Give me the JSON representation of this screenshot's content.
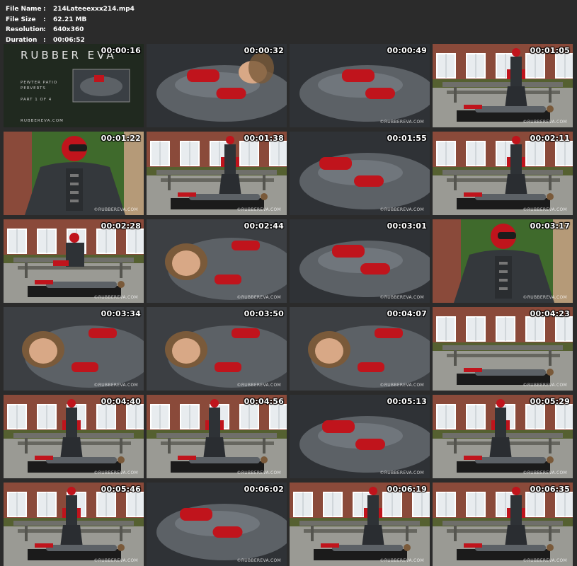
{
  "file_info": {
    "rows": [
      {
        "label": "File Name",
        "sep": ":",
        "value": "214Lateeexxx214.mp4"
      },
      {
        "label": "File Size",
        "sep": ":",
        "value": "62.21 MB"
      },
      {
        "label": "Resolution",
        "sep": ":",
        "value": "640x360"
      },
      {
        "label": "Duration",
        "sep": ":",
        "value": "00:06:52"
      }
    ]
  },
  "title_card": {
    "logo": "RUBBER EVA",
    "line1": "PEWTER PATIO",
    "line2": "PERVERTS",
    "part": "PART 1 OF 4",
    "site": "RUBBEREVA.COM"
  },
  "watermark": "©RUBBEREVA.COM",
  "thumbnails": [
    {
      "time": "00:00:16",
      "scene": "title"
    },
    {
      "time": "00:00:32",
      "scene": "closeup-lying"
    },
    {
      "time": "00:00:49",
      "scene": "closeup-hands"
    },
    {
      "time": "00:01:05",
      "scene": "patio-standing"
    },
    {
      "time": "00:01:22",
      "scene": "masked-portrait"
    },
    {
      "time": "00:01:38",
      "scene": "patio-standing"
    },
    {
      "time": "00:01:55",
      "scene": "closeup-hands"
    },
    {
      "time": "00:02:11",
      "scene": "patio-standing"
    },
    {
      "time": "00:02:28",
      "scene": "patio-kneeling"
    },
    {
      "time": "00:02:44",
      "scene": "closeup-face"
    },
    {
      "time": "00:03:01",
      "scene": "closeup-hands"
    },
    {
      "time": "00:03:17",
      "scene": "masked-portrait"
    },
    {
      "time": "00:03:34",
      "scene": "closeup-face"
    },
    {
      "time": "00:03:50",
      "scene": "closeup-face"
    },
    {
      "time": "00:04:07",
      "scene": "closeup-face"
    },
    {
      "time": "00:04:23",
      "scene": "patio-lying"
    },
    {
      "time": "00:04:40",
      "scene": "patio-seated"
    },
    {
      "time": "00:04:56",
      "scene": "patio-seated"
    },
    {
      "time": "00:05:13",
      "scene": "closeup-hands"
    },
    {
      "time": "00:05:29",
      "scene": "patio-seated"
    },
    {
      "time": "00:05:46",
      "scene": "patio-seated"
    },
    {
      "time": "00:06:02",
      "scene": "closeup-hands"
    },
    {
      "time": "00:06:19",
      "scene": "patio-standing"
    },
    {
      "time": "00:06:35",
      "scene": "patio-standing"
    }
  ],
  "colors": {
    "background": "#2b2b2b",
    "latex_grey": "#5c6166",
    "latex_red": "#c0141c",
    "brick": "#8a4a3a",
    "foliage": "#3f6a2c",
    "paving": "#9a9a94"
  }
}
